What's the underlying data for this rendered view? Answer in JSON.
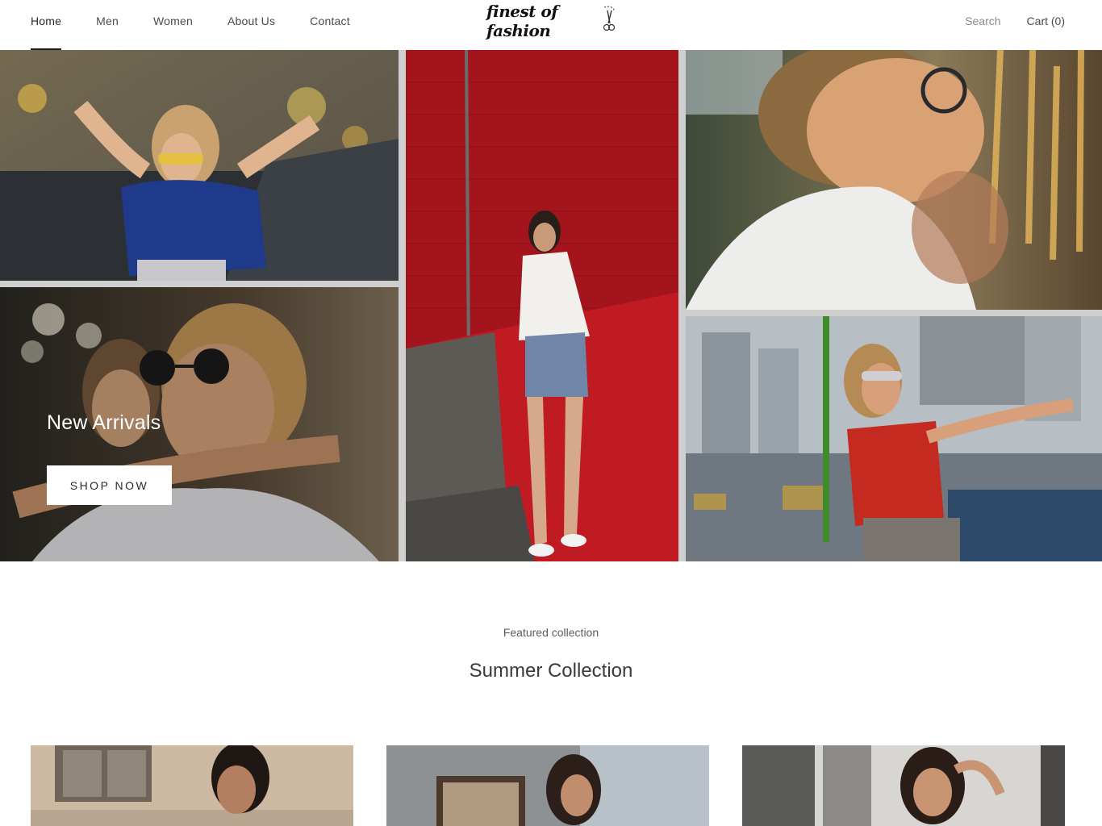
{
  "header": {
    "nav": [
      "Home",
      "Men",
      "Women",
      "About Us",
      "Contact"
    ],
    "active_nav": "Home",
    "logo_text": "finest of fashion",
    "search_label": "Search",
    "cart_label": "Cart (0)"
  },
  "hero": {
    "caption": "New Arrivals",
    "button_label": "SHOP NOW"
  },
  "featured": {
    "subtitle": "Featured collection",
    "title": "Summer Collection"
  },
  "colors": {
    "text": "#1c1b1b",
    "accent_red": "#b5141c",
    "background": "#ffffff"
  },
  "icons": [
    "scissors-icon"
  ]
}
